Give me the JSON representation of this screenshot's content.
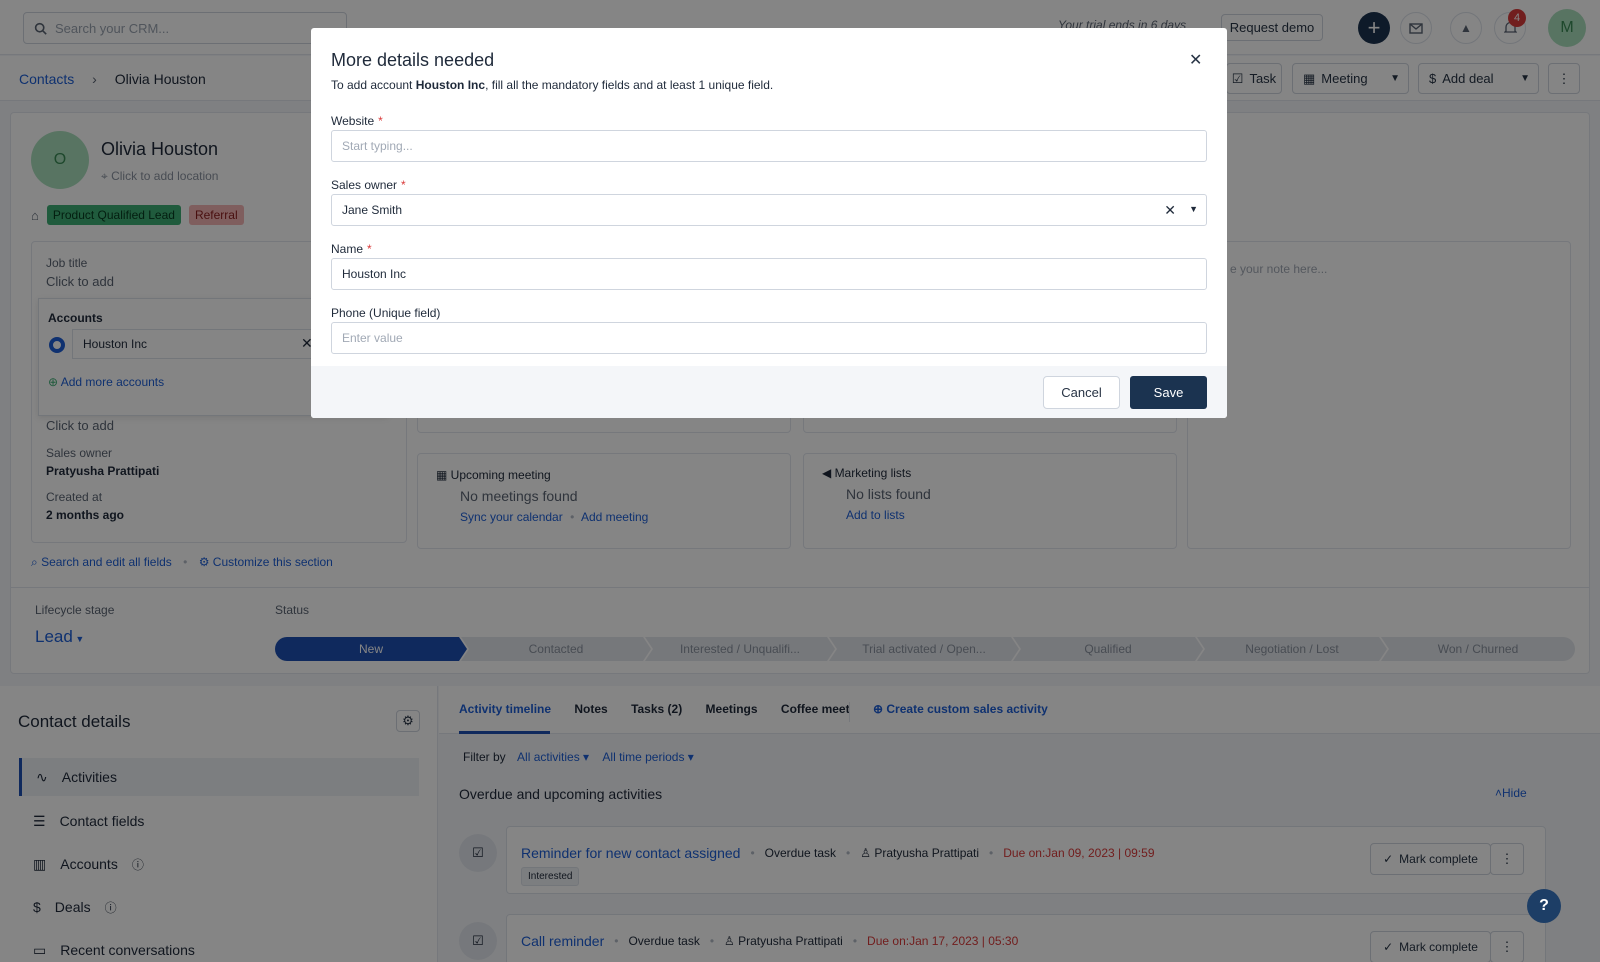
{
  "topbar": {
    "search_placeholder": "Search your CRM...",
    "trial_text": "Your trial ends in 6 days",
    "request_demo": "Request demo",
    "notification_count": "4",
    "avatar_initial": "M"
  },
  "breadcrumb": {
    "parent": "Contacts",
    "current": "Olivia Houston"
  },
  "actions": {
    "task": "Task",
    "meeting": "Meeting",
    "add_deal": "Add deal"
  },
  "contact": {
    "initial": "O",
    "name": "Olivia Houston",
    "location_placeholder": "Click to add location",
    "tags": [
      "Product Qualified Lead",
      "Referral"
    ]
  },
  "fields": {
    "job_title_label": "Job title",
    "job_title_value": "Click to add",
    "accounts_label": "Accounts",
    "account_value": "Houston Inc",
    "add_more_accounts": "Add more accounts",
    "click_to_add": "Click to add",
    "sales_owner_label": "Sales owner",
    "sales_owner_value": "Pratyusha Prattipati",
    "created_label": "Created at",
    "created_value": "2 months ago",
    "search_edit": "Search and edit all fields",
    "customize": "Customize this section"
  },
  "note_placeholder": "e your note here...",
  "meeting_card": {
    "title": "Upcoming meeting",
    "empty": "No meetings found",
    "sync": "Sync your calendar",
    "add": "Add meeting"
  },
  "marketing_card": {
    "title": "Marketing lists",
    "empty": "No lists found",
    "add": "Add to lists"
  },
  "lifecycle": {
    "label": "Lifecycle stage",
    "value": "Lead",
    "status_label": "Status",
    "stages": [
      "New",
      "Contacted",
      "Interested / Unqualifi...",
      "Trial activated / Open...",
      "Qualified",
      "Negotiation / Lost",
      "Won / Churned"
    ]
  },
  "contact_details": {
    "title": "Contact details",
    "nav": [
      "Activities",
      "Contact fields",
      "Accounts",
      "Deals",
      "Recent conversations"
    ]
  },
  "activity": {
    "tabs": [
      "Activity timeline",
      "Notes",
      "Tasks (2)",
      "Meetings",
      "Coffee meet"
    ],
    "create_custom": "Create custom sales activity",
    "filter_by": "Filter by",
    "filter_activities": "All activities",
    "filter_periods": "All time periods",
    "section_title": "Overdue and upcoming activities",
    "hide": "Hide",
    "items": [
      {
        "title": "Reminder for new contact assigned",
        "type": "Overdue task",
        "owner": "Pratyusha Prattipati",
        "due": "Due on:Jan 09, 2023 | 09:59",
        "badge": "Interested",
        "action": "Mark complete"
      },
      {
        "title": "Call reminder",
        "type": "Overdue task",
        "owner": "Pratyusha Prattipati",
        "due": "Due on:Jan 17, 2023 | 05:30",
        "action": "Mark complete"
      }
    ]
  },
  "modal": {
    "title": "More details needed",
    "desc_prefix": "To add account ",
    "desc_account": "Houston Inc",
    "desc_suffix": ", fill all the mandatory fields and at least 1 unique field.",
    "website_label": "Website",
    "website_placeholder": "Start typing...",
    "owner_label": "Sales owner",
    "owner_value": "Jane Smith",
    "name_label": "Name",
    "name_value": "Houston Inc",
    "phone_label": "Phone (Unique field)",
    "phone_placeholder": "Enter value",
    "cancel": "Cancel",
    "save": "Save"
  },
  "help": "?"
}
